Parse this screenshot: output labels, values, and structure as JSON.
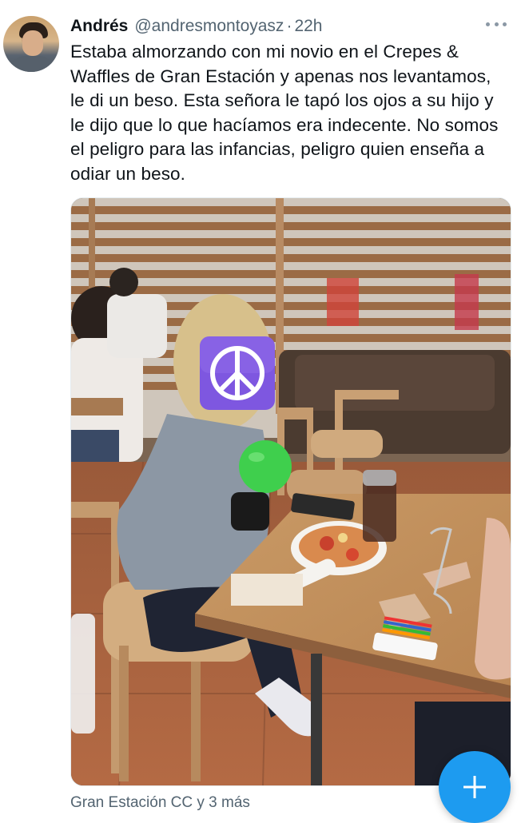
{
  "tweet": {
    "author_name": "Andrés",
    "author_handle": "@andresmontoyasz",
    "separator": "·",
    "time": "22h",
    "text": "Estaba almorzando con mi novio en el Crepes & Waffles de Gran Estación y apenas nos levantamos, le di un beso. Esta señora le tapó los ojos a su hijo y le dijo que lo que hacíamos era indecente. No somos el peligro para las infancias, peligro quien enseña a odiar un beso.",
    "location": "Gran Estación CC y 3 más",
    "emoji_overlay": "peace-symbol-icon"
  },
  "colors": {
    "accent": "#1d9bf0",
    "secondary_text": "#536471",
    "primary_text": "#0f1419",
    "peace_badge": "#7e57e0"
  },
  "fab": {
    "icon": "plus-icon"
  },
  "more_menu": {
    "icon": "more-horizontal-icon"
  }
}
